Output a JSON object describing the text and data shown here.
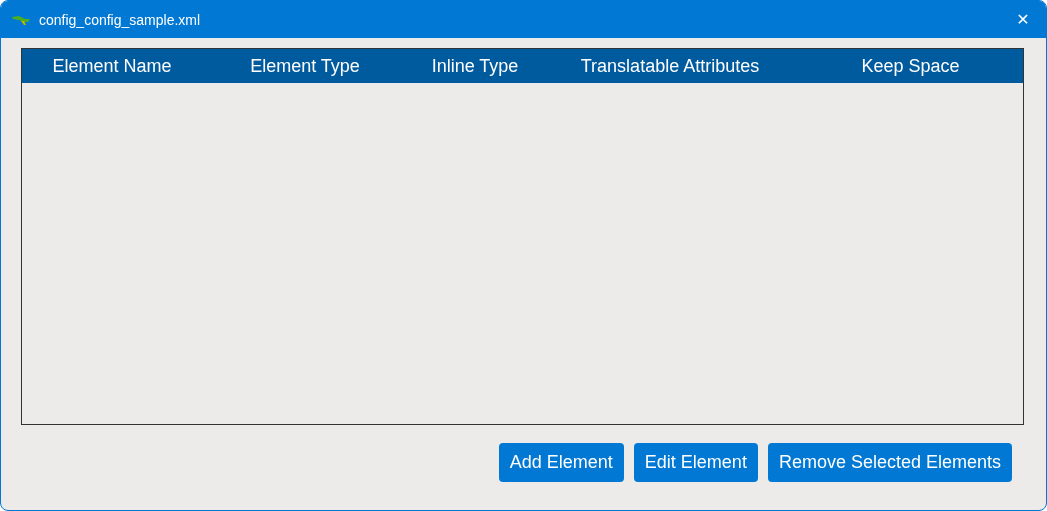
{
  "window": {
    "title": "config_config_sample.xml",
    "close": "✕"
  },
  "table": {
    "columns": [
      "Element Name",
      "Element Type",
      "Inline Type",
      "Translatable Attributes",
      "Keep Space"
    ]
  },
  "buttons": [
    "Add Element",
    "Edit Element",
    "Remove Selected Elements"
  ]
}
